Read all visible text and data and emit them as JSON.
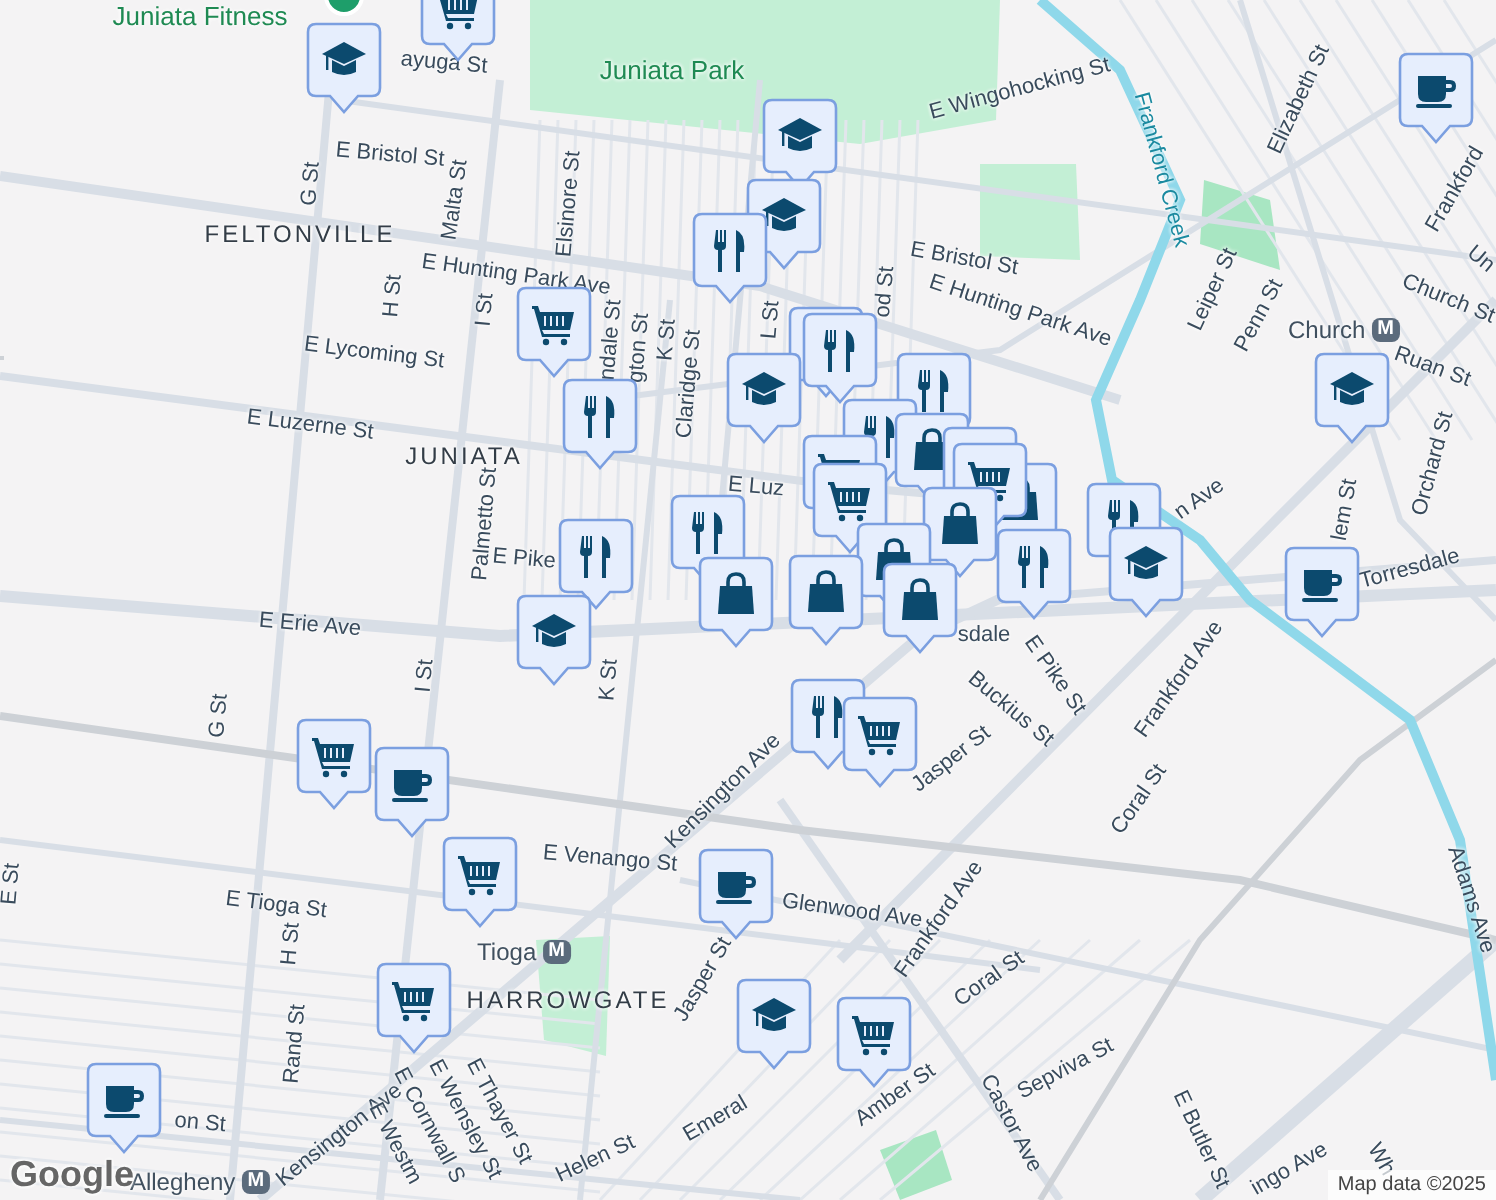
{
  "map": {
    "labels": [
      {
        "text": "Juniata Fitness",
        "kind": "place"
      },
      {
        "text": "Juniata Park",
        "kind": "park"
      },
      {
        "text": "ayuga St",
        "kind": "street"
      },
      {
        "text": "E Bristol St",
        "kind": "street"
      },
      {
        "text": "G St",
        "kind": "street"
      },
      {
        "text": "Malta St",
        "kind": "street"
      },
      {
        "text": "Elsinore St",
        "kind": "street"
      },
      {
        "text": "FELTONVILLE",
        "kind": "neighborhood"
      },
      {
        "text": "E Hunting Park Ave",
        "kind": "street"
      },
      {
        "text": "H St",
        "kind": "street"
      },
      {
        "text": "I St",
        "kind": "street"
      },
      {
        "text": "E Lycoming St",
        "kind": "street"
      },
      {
        "text": "ndale St",
        "kind": "street"
      },
      {
        "text": "gton St",
        "kind": "street"
      },
      {
        "text": "K St",
        "kind": "street"
      },
      {
        "text": "Claridge St",
        "kind": "street"
      },
      {
        "text": "E Luzerne St",
        "kind": "street"
      },
      {
        "text": "JUNIATA",
        "kind": "neighborhood"
      },
      {
        "text": "Palmetto St",
        "kind": "street"
      },
      {
        "text": "E Pike",
        "kind": "street"
      },
      {
        "text": "E Luz",
        "kind": "street"
      },
      {
        "text": "L St",
        "kind": "street"
      },
      {
        "text": "od St",
        "kind": "street"
      },
      {
        "text": "E Erie Ave",
        "kind": "street"
      },
      {
        "text": "sdale",
        "kind": "street"
      },
      {
        "text": "I St",
        "kind": "street"
      },
      {
        "text": "K St",
        "kind": "street"
      },
      {
        "text": "G St",
        "kind": "street"
      },
      {
        "text": "E Venango St",
        "kind": "street"
      },
      {
        "text": "E Tioga St",
        "kind": "street"
      },
      {
        "text": "E St",
        "kind": "street"
      },
      {
        "text": "H St",
        "kind": "street"
      },
      {
        "text": "Tioga",
        "kind": "station",
        "badge": "M"
      },
      {
        "text": "HARROWGATE",
        "kind": "neighborhood"
      },
      {
        "text": "Rand St",
        "kind": "street"
      },
      {
        "text": "on St",
        "kind": "street"
      },
      {
        "text": "Allegheny",
        "kind": "station",
        "badge": "M"
      },
      {
        "text": "Kensington Ave",
        "kind": "street"
      },
      {
        "text": "E Thayer St",
        "kind": "street"
      },
      {
        "text": "E Wensley St",
        "kind": "street"
      },
      {
        "text": "E Cornwall S",
        "kind": "street"
      },
      {
        "text": "E Westm",
        "kind": "street"
      },
      {
        "text": "Helen St",
        "kind": "street"
      },
      {
        "text": "Emeral",
        "kind": "street"
      },
      {
        "text": "Jasper St",
        "kind": "street"
      },
      {
        "text": "Glenwood Ave",
        "kind": "street"
      },
      {
        "text": "Kensington Ave",
        "kind": "street"
      },
      {
        "text": "Jasper St",
        "kind": "street"
      },
      {
        "text": "Buckius St",
        "kind": "street"
      },
      {
        "text": "E Pike St",
        "kind": "street"
      },
      {
        "text": "Frankford Ave",
        "kind": "street"
      },
      {
        "text": "Coral St",
        "kind": "street"
      },
      {
        "text": "Frankford Ave",
        "kind": "street"
      },
      {
        "text": "Coral St",
        "kind": "street"
      },
      {
        "text": "Amber St",
        "kind": "street"
      },
      {
        "text": "Castor Ave",
        "kind": "street"
      },
      {
        "text": "Sepviva St",
        "kind": "street"
      },
      {
        "text": "E Butler St",
        "kind": "street"
      },
      {
        "text": "ingo Ave",
        "kind": "street"
      },
      {
        "text": "Wh",
        "kind": "street"
      },
      {
        "text": "Adams Ave",
        "kind": "street"
      },
      {
        "text": "Torresdale",
        "kind": "street"
      },
      {
        "text": "lem St",
        "kind": "street"
      },
      {
        "text": "Orchard St",
        "kind": "street"
      },
      {
        "text": "Ruan St",
        "kind": "street"
      },
      {
        "text": "Church St",
        "kind": "street"
      },
      {
        "text": "Church",
        "kind": "station",
        "badge": "M"
      },
      {
        "text": "Penn St",
        "kind": "street"
      },
      {
        "text": "Leiper St",
        "kind": "street"
      },
      {
        "text": "Elizabeth St",
        "kind": "street"
      },
      {
        "text": "E Wingohocking St",
        "kind": "street"
      },
      {
        "text": "Frankford Creek",
        "kind": "water"
      },
      {
        "text": "E Bristol St",
        "kind": "street"
      },
      {
        "text": "E Hunting Park Ave",
        "kind": "street"
      },
      {
        "text": "Frankford",
        "kind": "street"
      },
      {
        "text": "Un",
        "kind": "street"
      },
      {
        "text": "n Ave",
        "kind": "street"
      }
    ],
    "markers": [
      {
        "kind": "grocery"
      },
      {
        "kind": "school"
      },
      {
        "kind": "school"
      },
      {
        "kind": "school"
      },
      {
        "kind": "restaurant"
      },
      {
        "kind": "grocery"
      },
      {
        "kind": "restaurant"
      },
      {
        "kind": "restaurant"
      },
      {
        "kind": "school"
      },
      {
        "kind": "restaurant"
      },
      {
        "kind": "restaurant"
      },
      {
        "kind": "restaurant"
      },
      {
        "kind": "restaurant"
      },
      {
        "kind": "shopping"
      },
      {
        "kind": "grocery"
      },
      {
        "kind": "grocery"
      },
      {
        "kind": "grocery"
      },
      {
        "kind": "shopping"
      },
      {
        "kind": "grocery"
      },
      {
        "kind": "shopping"
      },
      {
        "kind": "restaurant"
      },
      {
        "kind": "restaurant"
      },
      {
        "kind": "shopping"
      },
      {
        "kind": "shopping"
      },
      {
        "kind": "shopping"
      },
      {
        "kind": "shopping"
      },
      {
        "kind": "restaurant"
      },
      {
        "kind": "school"
      },
      {
        "kind": "school"
      },
      {
        "kind": "coffee"
      },
      {
        "kind": "school"
      },
      {
        "kind": "coffee"
      },
      {
        "kind": "grocery"
      },
      {
        "kind": "coffee"
      },
      {
        "kind": "restaurant"
      },
      {
        "kind": "grocery"
      },
      {
        "kind": "coffee"
      },
      {
        "kind": "grocery"
      },
      {
        "kind": "grocery"
      },
      {
        "kind": "school"
      },
      {
        "kind": "grocery"
      },
      {
        "kind": "coffee"
      }
    ],
    "logo": "Google",
    "attribution": "Map data ©2025"
  }
}
